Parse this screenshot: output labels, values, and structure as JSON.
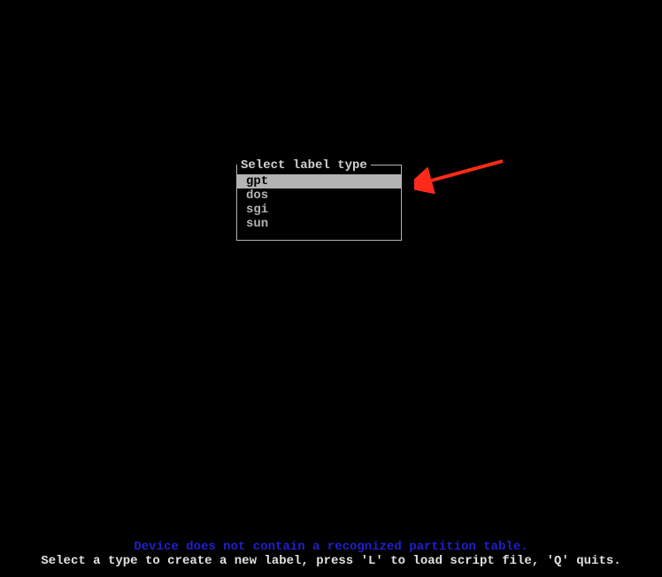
{
  "dialog": {
    "title": "Select label type",
    "options": [
      {
        "label": "gpt",
        "selected": true
      },
      {
        "label": "dos",
        "selected": false
      },
      {
        "label": "sgi",
        "selected": false
      },
      {
        "label": "sun",
        "selected": false
      }
    ]
  },
  "status": {
    "warning": "Device does not contain a recognized partition table.",
    "hint": "Select a type to create a new label, press 'L' to load script file, 'Q' quits."
  },
  "annotation": {
    "arrow_color": "#ff2a1a"
  }
}
